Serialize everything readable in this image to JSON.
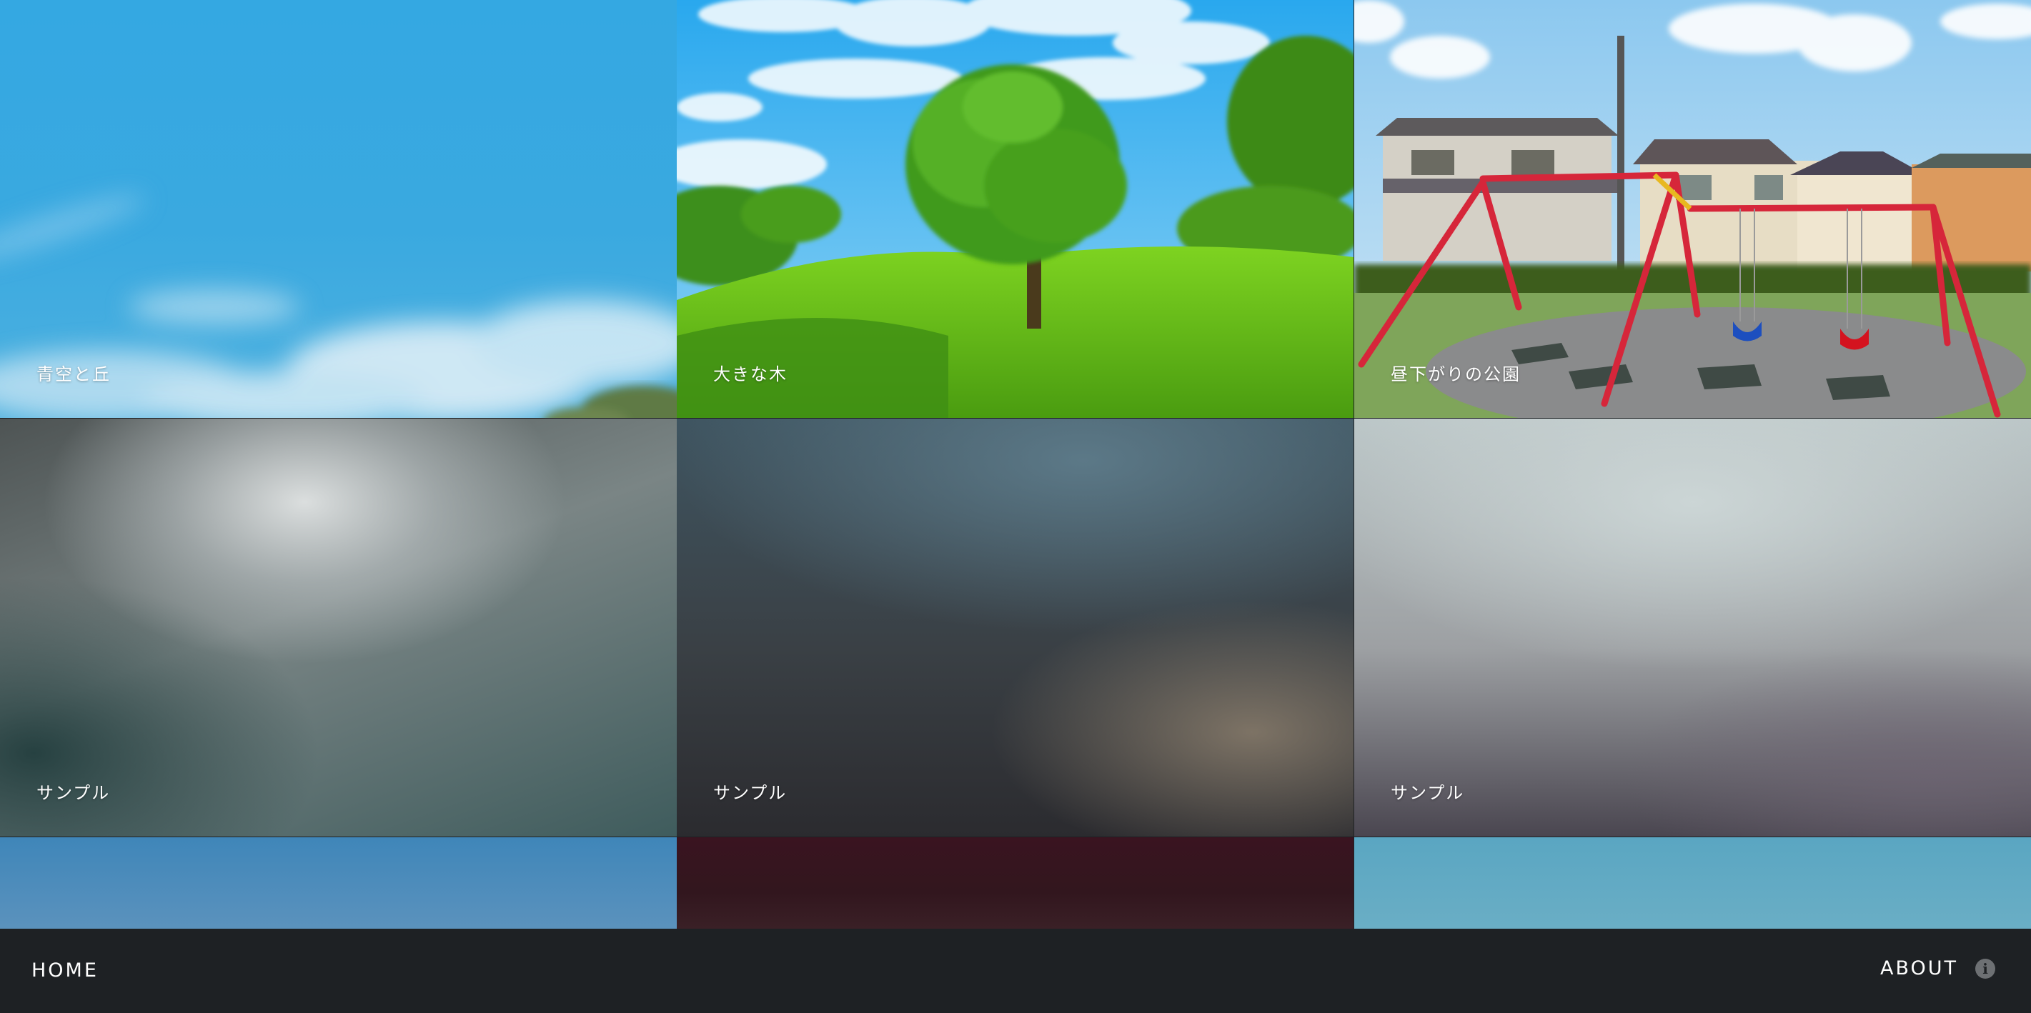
{
  "gallery": {
    "tiles": [
      {
        "caption": "青空と丘"
      },
      {
        "caption": "大きな木"
      },
      {
        "caption": "昼下がりの公園"
      },
      {
        "caption": "サンプル"
      },
      {
        "caption": "サンプル"
      },
      {
        "caption": "サンプル"
      },
      {
        "caption": ""
      },
      {
        "caption": ""
      },
      {
        "caption": ""
      }
    ]
  },
  "footer": {
    "home_label": "HOME",
    "about_label": "ABOUT",
    "about_icon": "info-icon"
  },
  "colors": {
    "footer_bg": "#1e2124",
    "caption_text": "#ffffff"
  }
}
